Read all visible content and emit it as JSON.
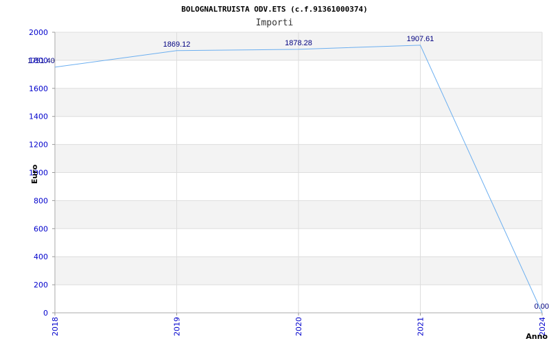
{
  "chart_data": {
    "type": "line",
    "title": "BOLOGNALTRUISTA ODV.ETS (c.f.91361000374)",
    "subtitle": "Importi",
    "xlabel": "Anno",
    "ylabel": "Euro",
    "categories": [
      "2018",
      "2019",
      "2020",
      "2021",
      "2024"
    ],
    "series": [
      {
        "values": [
          1751.4,
          1869.12,
          1878.28,
          1907.61,
          0.0
        ]
      }
    ],
    "data_labels": [
      "1751.40",
      "1869.12",
      "1878.28",
      "1907.61",
      "0.00"
    ],
    "y_ticks": [
      "0",
      "200",
      "400",
      "600",
      "800",
      "1000",
      "1200",
      "1400",
      "1600",
      "1800",
      "2000"
    ],
    "ylim": [
      0,
      2000
    ],
    "grid": true,
    "legend": "none",
    "colors": {
      "line": "#6aaef0",
      "band": "#f3f3f3",
      "grid": "#dddddd",
      "tick_text": "#0000cc",
      "data_label": "#000080"
    }
  }
}
